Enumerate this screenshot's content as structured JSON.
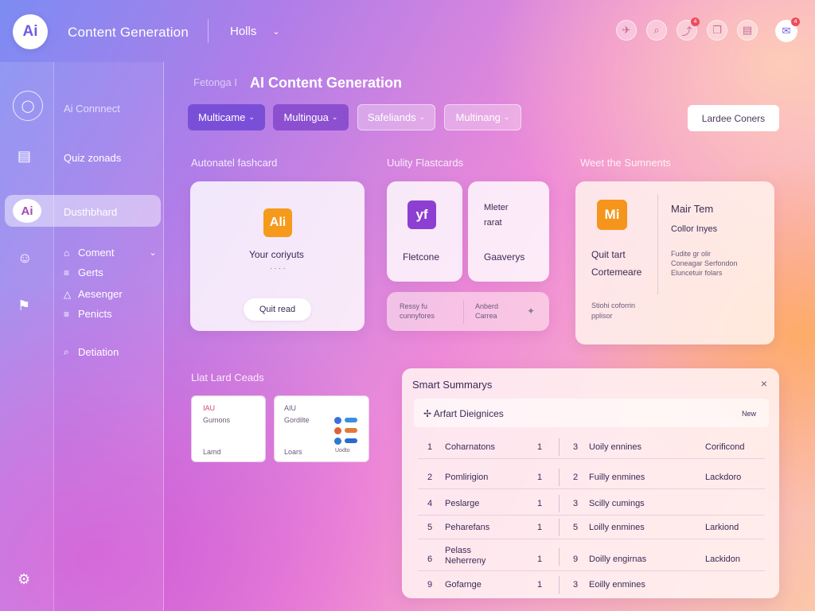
{
  "header": {
    "logo": "Ai",
    "title": "Content Generation",
    "workspace": "Holls",
    "icons": [
      {
        "name": "rocket-icon",
        "glyph": "✈",
        "badge": null
      },
      {
        "name": "search-icon",
        "glyph": "⌕",
        "badge": null
      },
      {
        "name": "chart-icon",
        "glyph": "⤴",
        "badge": "4"
      },
      {
        "name": "copy-icon",
        "glyph": "❐",
        "badge": null
      },
      {
        "name": "calendar-icon",
        "glyph": "▤",
        "badge": null
      },
      {
        "name": "notifications-icon",
        "glyph": "✉",
        "badge": "4"
      }
    ]
  },
  "sidebar": {
    "ai_connect": "Ai Connnect",
    "quiz": "Quiz zonads",
    "dashboard_badge": "Ai",
    "dashboard": "Dusthbhard",
    "sub_items": [
      {
        "icon": "⌂",
        "label": "Coment",
        "chevron": "⌄"
      },
      {
        "icon": "≡",
        "label": "Gerts",
        "chevron": ""
      },
      {
        "icon": "△",
        "label": "Aesenger",
        "chevron": ""
      },
      {
        "icon": "≡",
        "label": "Penicts",
        "chevron": ""
      }
    ],
    "search": "Detiation",
    "search_icon": "⌕"
  },
  "main": {
    "breadcrumb": "Fetonga I",
    "title": "AI Content Generation",
    "chips": [
      "Multicame",
      "Multingua",
      "Safeliands",
      "Multinang"
    ],
    "chip_chevron": "⌄",
    "primary_button": "Lardee Coners",
    "sections": {
      "flashcard": "Autonatel fashcard",
      "quality": "Uulity Flastcards",
      "summaries": "Weet the Sumnents",
      "list": "Llat Lard Ceads"
    },
    "card1": {
      "icon": "Ali",
      "text": "Your coriyuts",
      "dots": "· · · ·",
      "button": "Quit read"
    },
    "card2": {
      "icon": "yf",
      "text": "Fletcone"
    },
    "card3": {
      "line1": "Mleter",
      "line2": "rarat",
      "text": "Gaaverys"
    },
    "card4": {
      "left": "Ressy fu cunnyfores",
      "right": "Anberd Carrea",
      "action": "✦"
    },
    "card5": {
      "icon": "Mi",
      "title": "Mair Tem",
      "subtitle": "Collor Inyes",
      "quit": "Quit tart",
      "contemare": "Cortemeare",
      "small1": "Fudite gr olir",
      "small2": "Coneagar Serfondon",
      "small3": "Eluncetuir folars",
      "small4": "Stiohi coforrin",
      "small5": "pplisor"
    },
    "tiles": [
      {
        "top": "IAU",
        "mid": "Gumons",
        "bottom": "Lamd"
      },
      {
        "top": "AIU",
        "mid": "Gordilte",
        "bottom": "Loars",
        "extra": "Uodto"
      }
    ]
  },
  "panel": {
    "title": "Smart Summarys",
    "close": "×",
    "sub_icon": "✢",
    "sub_label": "Arfart Dieignices",
    "sub_badge": "New",
    "rows": [
      {
        "n": "1",
        "name": "Coharnatons",
        "c": "1",
        "m": "3",
        "desc": "Uoily ennines",
        "status": "Corificond"
      },
      {
        "n": "2",
        "name": "Pomlirigion",
        "c": "1",
        "m": "2",
        "desc": "Fuilly enmines",
        "status": "Lackdoro"
      },
      {
        "n": "4",
        "name": "Peslarge",
        "c": "1",
        "m": "3",
        "desc": "Scilly cumings",
        "status": ""
      },
      {
        "n": "5",
        "name": "Peharefans",
        "c": "1",
        "m": "5",
        "desc": "Loilly enmines",
        "status": "Larkiond"
      },
      {
        "n": "6",
        "name": "Pelass Neherreny",
        "c": "1",
        "m": "9",
        "desc": "Doilly engirnas",
        "status": "Lackidon"
      },
      {
        "n": "9",
        "name": "Gofarnge",
        "c": "1",
        "m": "3",
        "desc": "Eoilly enmines",
        "status": ""
      }
    ]
  }
}
